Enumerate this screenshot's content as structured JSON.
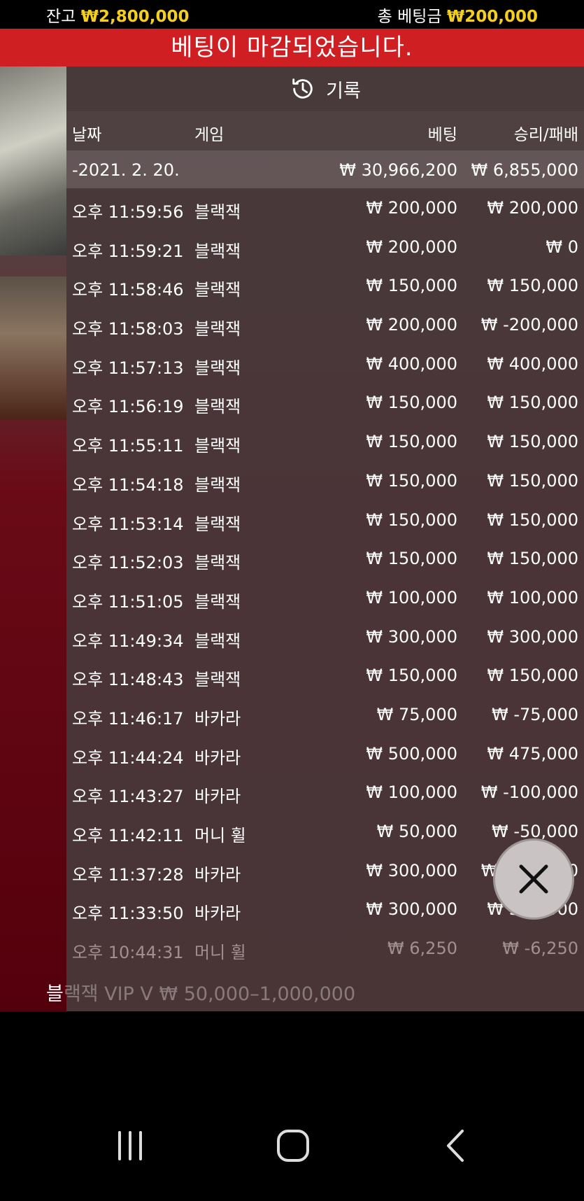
{
  "topbar": {
    "balance_label": "잔고",
    "balance_value": "₩2,800,000",
    "total_bet_label": "총 베팅금",
    "total_bet_value": "₩200,000"
  },
  "banner": {
    "text": "베팅이 마감되었습니다."
  },
  "panel": {
    "title": "기록",
    "title_icon": "history-icon",
    "headers": {
      "date": "날짜",
      "game": "게임",
      "bet": "베팅",
      "winloss": "승리/패배"
    },
    "date_row": {
      "date": "-2021. 2. 20.",
      "bet": "₩ 30,966,200",
      "winloss": "₩ 6,855,000"
    },
    "rows": [
      {
        "time": "오후 11:59:56",
        "game": "블랙잭",
        "bet": "₩ 200,000",
        "winloss": "₩ 200,000"
      },
      {
        "time": "오후 11:59:21",
        "game": "블랙잭",
        "bet": "₩ 200,000",
        "winloss": "₩ 0"
      },
      {
        "time": "오후 11:58:46",
        "game": "블랙잭",
        "bet": "₩ 150,000",
        "winloss": "₩ 150,000"
      },
      {
        "time": "오후 11:58:03",
        "game": "블랙잭",
        "bet": "₩ 200,000",
        "winloss": "₩ -200,000"
      },
      {
        "time": "오후 11:57:13",
        "game": "블랙잭",
        "bet": "₩ 400,000",
        "winloss": "₩ 400,000"
      },
      {
        "time": "오후 11:56:19",
        "game": "블랙잭",
        "bet": "₩ 150,000",
        "winloss": "₩ 150,000"
      },
      {
        "time": "오후 11:55:11",
        "game": "블랙잭",
        "bet": "₩ 150,000",
        "winloss": "₩ 150,000"
      },
      {
        "time": "오후 11:54:18",
        "game": "블랙잭",
        "bet": "₩ 150,000",
        "winloss": "₩ 150,000"
      },
      {
        "time": "오후 11:53:14",
        "game": "블랙잭",
        "bet": "₩ 150,000",
        "winloss": "₩ 150,000"
      },
      {
        "time": "오후 11:52:03",
        "game": "블랙잭",
        "bet": "₩ 150,000",
        "winloss": "₩ 150,000"
      },
      {
        "time": "오후 11:51:05",
        "game": "블랙잭",
        "bet": "₩ 100,000",
        "winloss": "₩ 100,000"
      },
      {
        "time": "오후 11:49:34",
        "game": "블랙잭",
        "bet": "₩ 300,000",
        "winloss": "₩ 300,000"
      },
      {
        "time": "오후 11:48:43",
        "game": "블랙잭",
        "bet": "₩ 150,000",
        "winloss": "₩ 150,000"
      },
      {
        "time": "오후 11:46:17",
        "game": "바카라",
        "bet": "₩ 75,000",
        "winloss": "₩ -75,000"
      },
      {
        "time": "오후 11:44:24",
        "game": "바카라",
        "bet": "₩ 500,000",
        "winloss": "₩ 475,000"
      },
      {
        "time": "오후 11:43:27",
        "game": "바카라",
        "bet": "₩ 100,000",
        "winloss": "₩ -100,000"
      },
      {
        "time": "오후 11:42:11",
        "game": "머니 휠",
        "bet": "₩ 50,000",
        "winloss": "₩ -50,000"
      },
      {
        "time": "오후 11:37:28",
        "game": "바카라",
        "bet": "₩ 300,000",
        "winloss": "₩ -300,000"
      },
      {
        "time": "오후 11:33:50",
        "game": "바카라",
        "bet": "₩ 300,000",
        "winloss": "₩ 300,000"
      },
      {
        "time": "오후 10:44:31",
        "game": "머니 휠",
        "bet": "₩ 6,250",
        "winloss": "₩ -6,250"
      }
    ]
  },
  "footer": {
    "first": "블",
    "rest": "랙잭 VIP V  ₩ 50,000–1,000,000"
  },
  "close_button": {
    "icon": "close-icon"
  },
  "navbar": {
    "recents_icon": "recents-icon",
    "home_icon": "home-icon",
    "back_icon": "back-icon"
  }
}
